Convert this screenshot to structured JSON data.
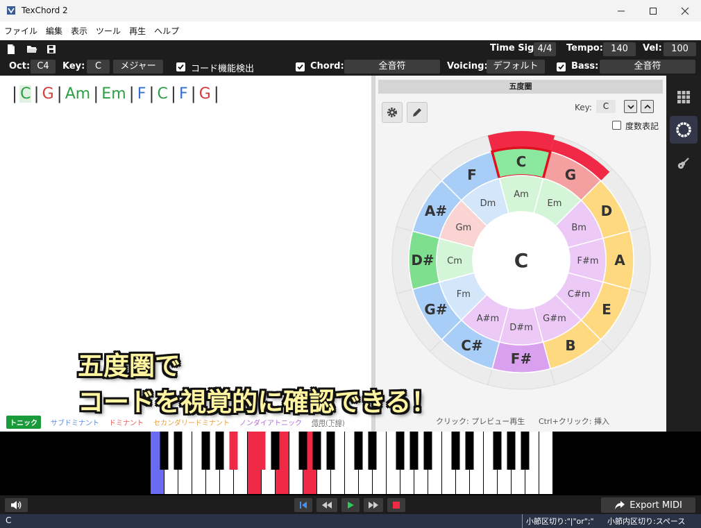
{
  "window": {
    "title": "TexChord 2"
  },
  "menu": [
    "ファイル",
    "編集",
    "表示",
    "ツール",
    "再生",
    "ヘルプ"
  ],
  "toolbar1": {
    "time_sig_label": "Time Sig:",
    "time_sig_value": "4/4",
    "tempo_label": "Tempo:",
    "tempo_value": "140",
    "vel_label": "Vel:",
    "vel_value": "100"
  },
  "toolbar2": {
    "oct_label": "Oct:",
    "oct_value": "C4",
    "key_label": "Key:",
    "key_value": "C",
    "mode_value": "メジャー",
    "detect_label": "コード機能検出",
    "chord_label": "Chord:",
    "chord_value": "全音符",
    "voicing_label": "Voicing:",
    "voicing_value": "デフォルト",
    "bass_label": "Bass:",
    "bass_value": "全音符"
  },
  "editor": {
    "chords": [
      {
        "text": "C",
        "color": "#2e9e44",
        "selected": true
      },
      {
        "text": "G",
        "color": "#d23b3b",
        "selected": false
      },
      {
        "text": "Am",
        "color": "#2e9e44",
        "selected": false
      },
      {
        "text": "Em",
        "color": "#2e9e44",
        "selected": false
      },
      {
        "text": "F",
        "color": "#2f6fd1",
        "selected": false
      },
      {
        "text": "C",
        "color": "#2e9e44",
        "selected": false
      },
      {
        "text": "F",
        "color": "#2f6fd1",
        "selected": false
      },
      {
        "text": "G",
        "color": "#d23b3b",
        "selected": false
      }
    ]
  },
  "legend": {
    "tonic": "トニック",
    "subdominant": "サブドミナント",
    "dominant": "ドミナント",
    "secondary": "セカンダリードミナント",
    "nondiatonic": "ノンダイアトニック",
    "borrowed": "借用(下線)"
  },
  "circle_panel": {
    "title": "五度圏",
    "key_label": "Key:",
    "key_value": "C",
    "degree_label": "度数表記",
    "center": "C",
    "major": [
      {
        "name": "C",
        "color": "#8de89f"
      },
      {
        "name": "G",
        "color": "#f5a0a0"
      },
      {
        "name": "D",
        "color": "#ffd980"
      },
      {
        "name": "A",
        "color": "#ffd980"
      },
      {
        "name": "E",
        "color": "#ffd980"
      },
      {
        "name": "B",
        "color": "#ffd980"
      },
      {
        "name": "F#",
        "color": "#d9a0f0"
      },
      {
        "name": "C#",
        "color": "#a8cdf7"
      },
      {
        "name": "G#",
        "color": "#a8cdf7"
      },
      {
        "name": "D#",
        "color": "#7ee08f"
      },
      {
        "name": "A#",
        "color": "#a8cdf7"
      },
      {
        "name": "F",
        "color": "#a8cdf7"
      }
    ],
    "minor": [
      {
        "name": "Am",
        "color": "#d4f5d8"
      },
      {
        "name": "Em",
        "color": "#d4f5d8"
      },
      {
        "name": "Bm",
        "color": "#ecc9f7"
      },
      {
        "name": "F#m",
        "color": "#ecc9f7"
      },
      {
        "name": "C#m",
        "color": "#ecc9f7"
      },
      {
        "name": "G#m",
        "color": "#ecc9f7"
      },
      {
        "name": "D#m",
        "color": "#ecc9f7"
      },
      {
        "name": "A#m",
        "color": "#ecc9f7"
      },
      {
        "name": "Fm",
        "color": "#d3e6fa"
      },
      {
        "name": "Cm",
        "color": "#d4f5d8"
      },
      {
        "name": "Gm",
        "color": "#fad3d3"
      },
      {
        "name": "Dm",
        "color": "#d3e6fa"
      }
    ],
    "highlight_color": "#f02a46",
    "hint_click": "クリック: プレビュー再生",
    "hint_ctrl": "Ctrl+クリック: 挿入"
  },
  "piano": {
    "white_keys": 29,
    "pressed_white": [
      0,
      7,
      9,
      11
    ],
    "pressed_white_colors": [
      "#6a6af2",
      "#f02a46",
      "#f02a46",
      "#f02a46"
    ],
    "pressed_black": [
      5,
      7
    ],
    "pressed_black_color": "#f02a46"
  },
  "transport": {
    "export_label": "Export MIDI"
  },
  "status": {
    "left": "C",
    "bar_sep": "小節区切り:\"|\"or\";\"",
    "inner_sep": "小節内区切り:スペース"
  },
  "caption": {
    "line1": "五度圏で",
    "line2": "コードを視覚的に確認できる！"
  }
}
